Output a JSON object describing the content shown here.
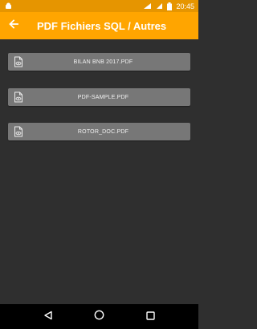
{
  "status_bar": {
    "time": "20:45",
    "icons": [
      "android-icon",
      "signal-4g-icon",
      "signal-icon",
      "battery-icon"
    ]
  },
  "app_bar": {
    "title": "PDF Fichiers SQL / Autres",
    "back_icon": "arrow-left-icon"
  },
  "files": [
    {
      "label": "BILAN BNB 2017.PDF",
      "icon": "pdf-view-icon"
    },
    {
      "label": "PDF-SAMPLE.PDF",
      "icon": "pdf-view-icon"
    },
    {
      "label": "ROTOR_DOC.PDF",
      "icon": "pdf-view-icon"
    }
  ],
  "nav_bar": {
    "icons": [
      "back-triangle-icon",
      "home-circle-icon",
      "recents-square-icon"
    ]
  },
  "colors": {
    "app_bar": "#ffa500",
    "status_bar": "#e69500",
    "background": "#2f2f2f",
    "button": "#777777",
    "nav_bar": "#000000"
  }
}
